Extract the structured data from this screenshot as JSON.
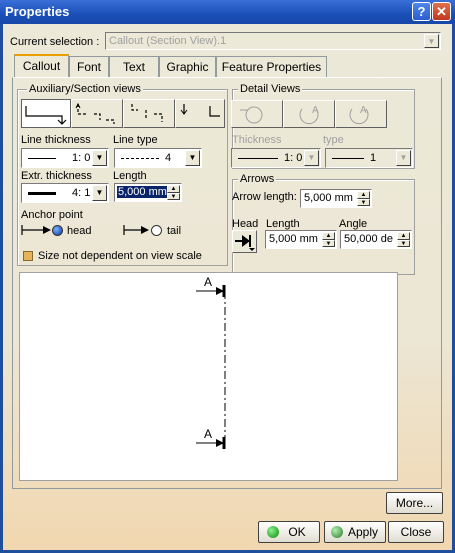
{
  "window": {
    "title": "Properties",
    "help_glyph": "?",
    "close_glyph": "✕"
  },
  "selection": {
    "label": "Current selection :",
    "value": "Callout (Section View).1"
  },
  "tabs": [
    {
      "label": "Callout",
      "active": true
    },
    {
      "label": "Font"
    },
    {
      "label": "Text"
    },
    {
      "label": "Graphic"
    },
    {
      "label": "Feature Properties"
    }
  ],
  "aux": {
    "legend": "Auxiliary/Section views",
    "line_thickness_label": "Line thickness",
    "line_thickness_value": "1: 0",
    "line_type_label": "Line type",
    "line_type_value": "4",
    "extr_thickness_label": "Extr. thickness",
    "extr_thickness_value": "4: 1",
    "length_label": "Length",
    "length_value": "5,000 mm",
    "anchor_label": "Anchor point",
    "head_label": "head",
    "tail_label": "tail",
    "anchor_selected": "head",
    "scale_checkbox_label": "Size not dependent on view scale",
    "scale_checkbox_checked": false
  },
  "detail": {
    "legend": "Detail Views",
    "thickness_label": "Thickness",
    "thickness_value": "1: 0",
    "type_label": "type",
    "type_value": "1",
    "icon_letter": "A"
  },
  "arrows": {
    "legend": "Arrows",
    "arrow_length_label": "Arrow length:",
    "arrow_length_value": "5,000 mm",
    "head_label": "Head",
    "length_label": "Length",
    "length_value": "5,000 mm",
    "angle_label": "Angle",
    "angle_value": "50,000 de"
  },
  "preview": {
    "top_letter": "A",
    "bottom_letter": "A"
  },
  "buttons": {
    "more": "More...",
    "ok": "OK",
    "apply": "Apply",
    "close": "Close"
  }
}
